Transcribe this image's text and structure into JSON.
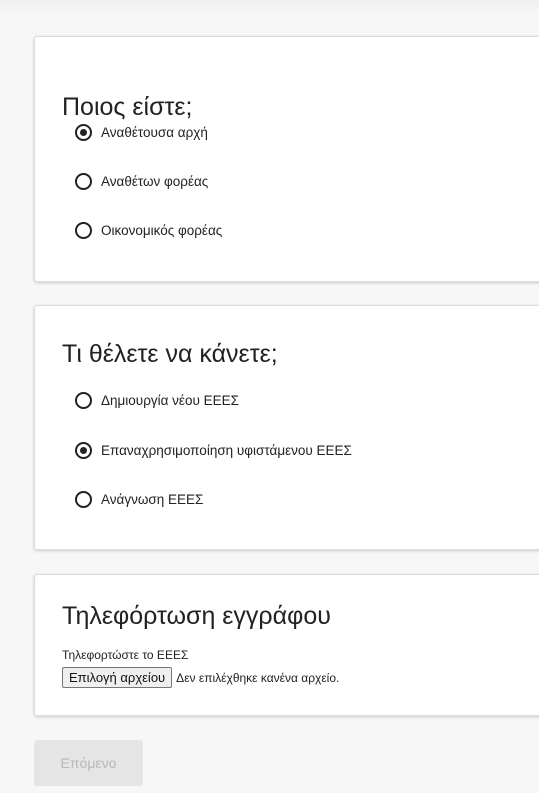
{
  "who_section": {
    "title": "Ποιος είστε;",
    "options": [
      {
        "label": "Αναθέτουσα αρχή",
        "selected": true
      },
      {
        "label": "Αναθέτων φορέας",
        "selected": false
      },
      {
        "label": "Οικονομικός φορέας",
        "selected": false
      }
    ]
  },
  "what_section": {
    "title": "Τι θέλετε να κάνετε;",
    "options": [
      {
        "label": "Δημιουργία νέου ΕΕΕΣ",
        "selected": false
      },
      {
        "label": "Επαναχρησιμοποίηση υφιστάμενου ΕΕΕΣ",
        "selected": true
      },
      {
        "label": "Ανάγνωση ΕΕΕΣ",
        "selected": false
      }
    ]
  },
  "upload_section": {
    "title": "Τηλεφόρτωση εγγράφου",
    "hint": "Τηλεφορτώστε το ΕΕΕΣ",
    "file_button_label": "Επιλογή αρχείου",
    "file_status": "Δεν επιλέχθηκε κανένα αρχείο."
  },
  "next_button_label": "Επόμενο"
}
